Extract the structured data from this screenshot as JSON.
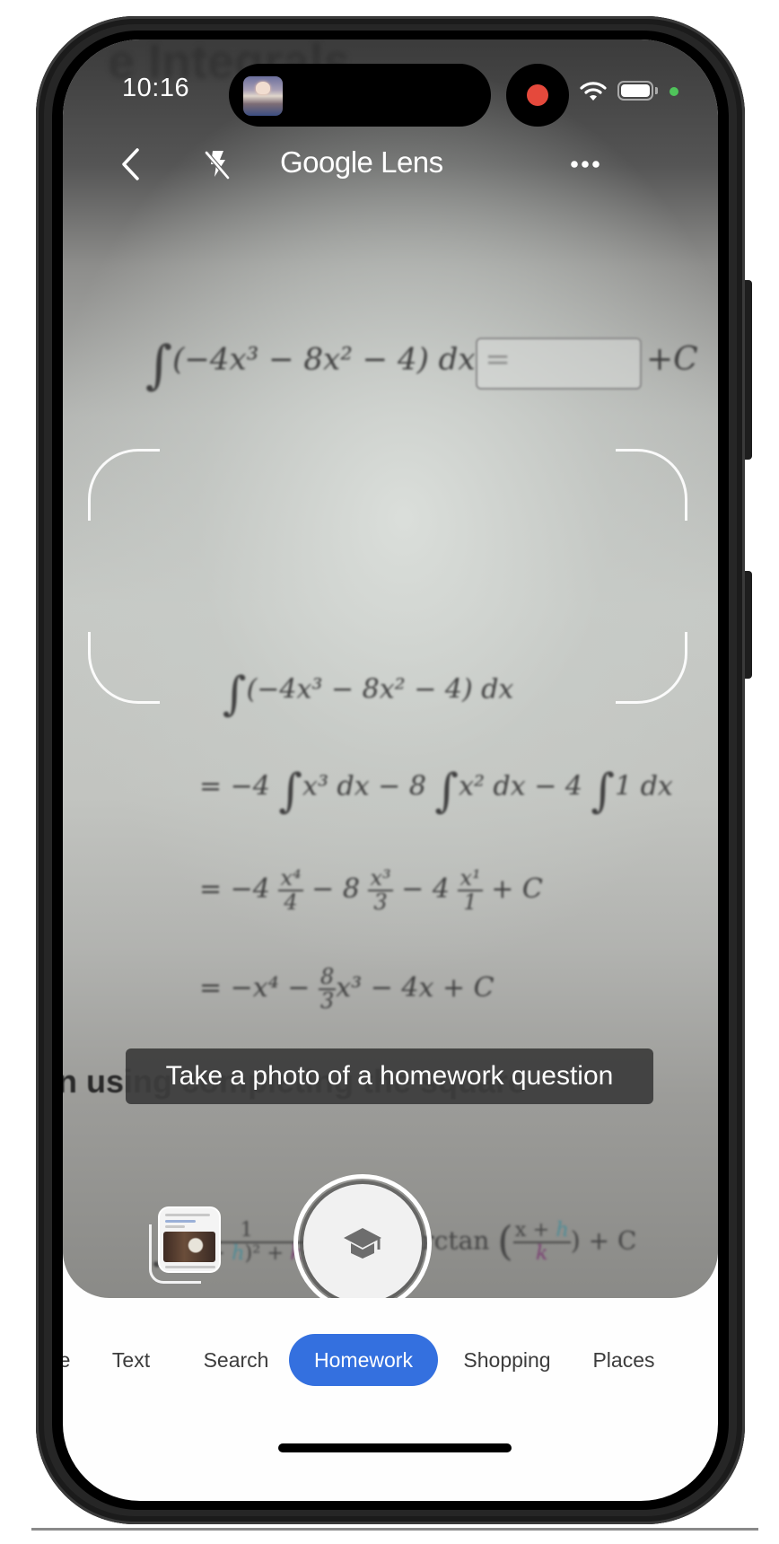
{
  "status_bar": {
    "time": "10:16",
    "recording": true,
    "wifi_icon": "wifi-icon",
    "battery_icon": "battery-icon"
  },
  "top_bar": {
    "back_icon": "chevron-left-icon",
    "flash_icon": "flash-off-icon",
    "title_google": "Google",
    "title_lens": "Lens",
    "more_icon": "more-horizontal-icon"
  },
  "camera_scene": {
    "blurred_heading_top": "e Integrals",
    "problem_integrand": "(−4x³ − 8x² − 4) dx =",
    "problem_constant": "+C",
    "step1": "(−4x³ − 8x² − 4) dx",
    "step2_parts": [
      "= −4",
      "x³ dx − 8",
      "x² dx − 4",
      "1 dx"
    ],
    "step3": {
      "prefix": "= −4",
      "f1_num": "x⁴",
      "f1_den": "4",
      "mid1": "− 8",
      "f2_num": "x³",
      "f2_den": "3",
      "mid2": "− 4",
      "f3_num": "x¹",
      "f3_den": "1",
      "suffix": "+ C"
    },
    "step4": {
      "prefix": "= −x⁴ −",
      "f_num": "8",
      "f_den": "3",
      "suffix": "x³ − 4x + C"
    },
    "blurred_heading_bottom": "n using completing the square",
    "formula": {
      "num": "1",
      "den_a": "(x + ",
      "den_h": "h",
      "den_b": ")² + ",
      "den_k": "k",
      "den_c": "²",
      "rhs": "arctan",
      "rhs_num_a": "x + ",
      "rhs_num_h": "h",
      "rhs_den_k": "k",
      "rhs_tail": ") + C"
    }
  },
  "hint": "Take a photo of a homework question",
  "shutter": {
    "icon": "graduation-cap-icon"
  },
  "gallery": {
    "icon": "recent-screenshot-thumbnail"
  },
  "mode_tabs": [
    {
      "label": "e",
      "active": false
    },
    {
      "label": "Text",
      "active": false
    },
    {
      "label": "Search",
      "active": false
    },
    {
      "label": "Homework",
      "active": true
    },
    {
      "label": "Shopping",
      "active": false
    },
    {
      "label": "Places",
      "active": false
    }
  ],
  "colors": {
    "active_tab": "#3470df",
    "record_dot": "#e5493c",
    "privacy_dot": "#4fc45a"
  }
}
